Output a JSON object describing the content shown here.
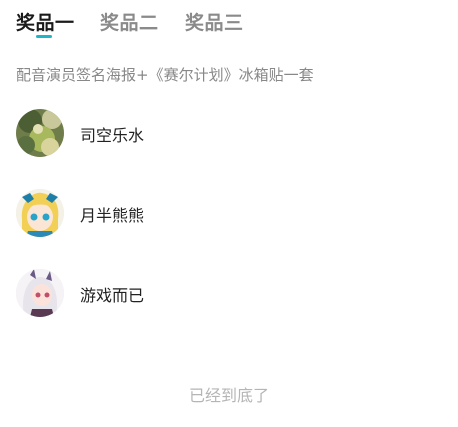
{
  "tabs": [
    {
      "label": "奖品一",
      "active": true
    },
    {
      "label": "奖品二",
      "active": false
    },
    {
      "label": "奖品三",
      "active": false
    }
  ],
  "accent_color": "#1fb5c8",
  "prize": {
    "description": "配音演员签名海报+《赛尔计划》冰箱贴一套"
  },
  "winners": [
    {
      "name": "司空乐水",
      "avatar_icon": "nature-photo-avatar"
    },
    {
      "name": "月半熊熊",
      "avatar_icon": "anime-girl-blue-avatar"
    },
    {
      "name": "游戏而已",
      "avatar_icon": "anime-girl-white-hair-avatar"
    }
  ],
  "footer": {
    "end_text": "已经到底了"
  }
}
